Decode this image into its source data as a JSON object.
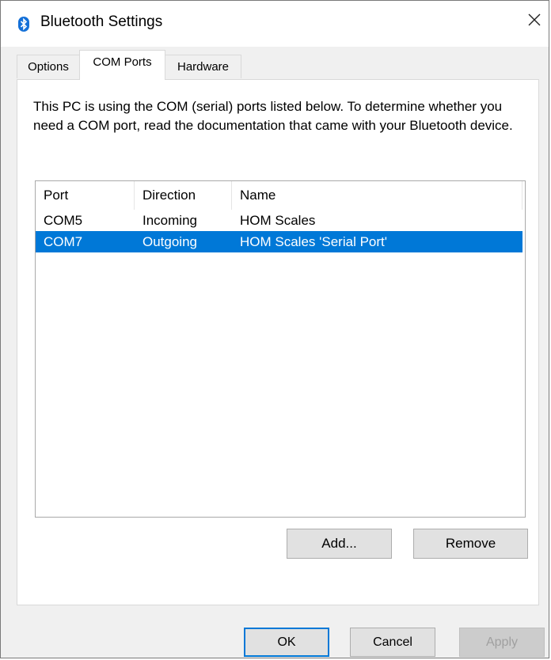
{
  "window": {
    "title": "Bluetooth Settings",
    "icon": "bluetooth-icon",
    "close_icon": "close-icon"
  },
  "tabs": [
    {
      "label": "Options",
      "selected": false
    },
    {
      "label": "COM Ports",
      "selected": true
    },
    {
      "label": "Hardware",
      "selected": false
    }
  ],
  "description": "This PC is using the COM (serial) ports listed below. To determine whether you need a COM port, read the documentation that came with your Bluetooth device.",
  "port_list": {
    "columns": [
      "Port",
      "Direction",
      "Name"
    ],
    "rows": [
      {
        "port": "COM5",
        "direction": "Incoming",
        "name": "HOM Scales",
        "selected": false
      },
      {
        "port": "COM7",
        "direction": "Outgoing",
        "name": "HOM Scales 'Serial Port'",
        "selected": true
      }
    ],
    "selection_color": "#0078d7"
  },
  "buttons": {
    "add": "Add...",
    "remove": "Remove",
    "ok": "OK",
    "cancel": "Cancel",
    "apply": "Apply"
  }
}
